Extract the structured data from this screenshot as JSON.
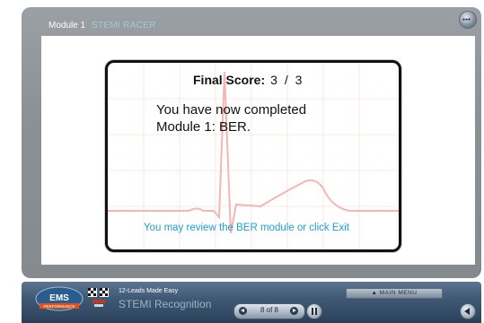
{
  "header": {
    "module_label": "Module 1",
    "module_subtitle": "STEMI RACER"
  },
  "score_card": {
    "final_label": "Final Score:",
    "score_value": "3  /  3",
    "message_line1": "You have now completed",
    "message_line2": "Module 1: BER.",
    "review_text": "You may review the BER module or click Exit"
  },
  "navbar": {
    "logo_text_top": "EMS",
    "logo_text_bottom": "PERFORMANCE",
    "course_title": "12-Leads Made Easy",
    "course_subtitle": "STEMI Recognition",
    "main_menu_label": "▲  MAIN MENU",
    "page_indicator": "8 of 8"
  },
  "colors": {
    "frame_gray": "#8c9196",
    "nav_blue": "#3f5873",
    "review_blue": "#1a9fd8",
    "ecg_pink": "#f4b5b5"
  }
}
